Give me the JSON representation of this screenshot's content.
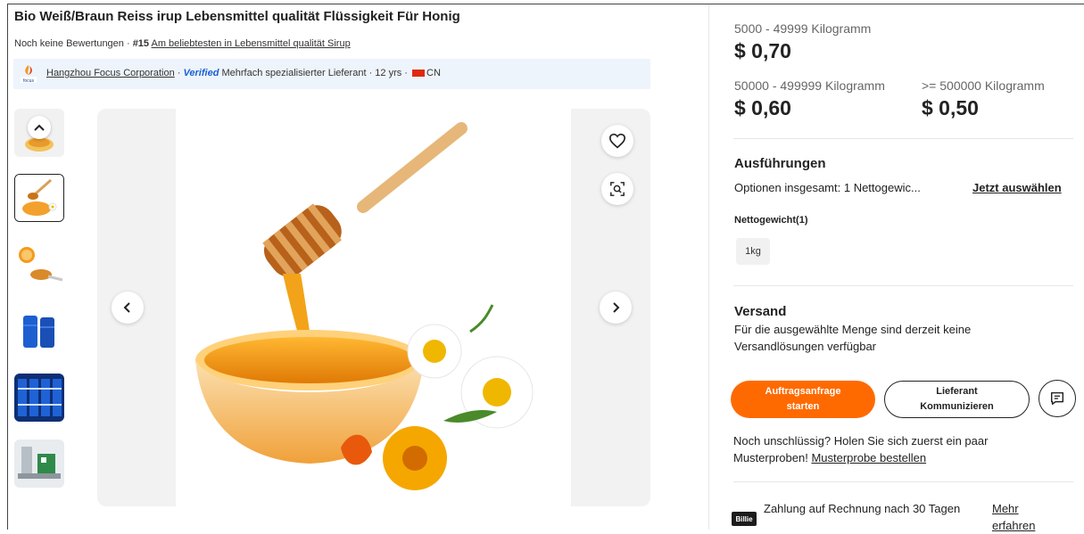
{
  "product": {
    "title": "Bio Weiß/Braun Reiss irup Lebensmittel qualität Flüssigkeit Für Honig",
    "reviews": "Noch keine Bewertungen · ",
    "rank": "#15",
    "rank_link": "Am beliebtesten in Lebensmittel qualität Sirup"
  },
  "supplier": {
    "name": "Hangzhou Focus Corporation",
    "sep": " · ",
    "verified": "Verified",
    "description": " Mehrfach spezialisierter Lieferant · 12 yrs · ",
    "country": "CN"
  },
  "gallery": {
    "thumbnails": [
      {
        "name": "honey-bowl-top",
        "active": false
      },
      {
        "name": "honey-dipper-bowl",
        "active": true
      },
      {
        "name": "honey-orange-spoon",
        "active": false
      },
      {
        "name": "blue-barrels",
        "active": false
      },
      {
        "name": "blue-containers-stacked",
        "active": false
      },
      {
        "name": "production-machine",
        "active": false
      }
    ]
  },
  "pricing": {
    "tiers": [
      {
        "qty": "5000 - 49999 Kilogramm",
        "price": "$ 0,70"
      },
      {
        "qty": "50000 - 499999 Kilogramm",
        "price": "$ 0,60"
      },
      {
        "qty": ">= 500000 Kilogramm",
        "price": "$ 0,50"
      }
    ]
  },
  "variants": {
    "heading": "Ausführungen",
    "options_text": "Optionen insgesamt: 1 Nettogewic...",
    "select_link": "Jetzt auswählen",
    "attribute_label": "Nettogewicht(1)",
    "chip": "1kg"
  },
  "shipping": {
    "heading": "Versand",
    "text": "Für die ausgewählte Menge sind derzeit keine Versandlösungen verfügbar"
  },
  "actions": {
    "primary_line1": "Auftragsanfrage",
    "primary_line2": "starten",
    "secondary_line1": "Lieferant",
    "secondary_line2": "Kommunizieren"
  },
  "samples": {
    "text": "Noch unschlüssig? Holen Sie sich zuerst ein paar Musterproben! ",
    "link": "Musterprobe bestellen"
  },
  "payment": {
    "logo": "Billie",
    "text": "Zahlung auf Rechnung nach 30 Tagen",
    "more": "Mehr erfahren"
  },
  "colors": {
    "accent": "#ff6a00",
    "verified": "#1a5fd0",
    "supplier_bar": "#eef4fc"
  }
}
